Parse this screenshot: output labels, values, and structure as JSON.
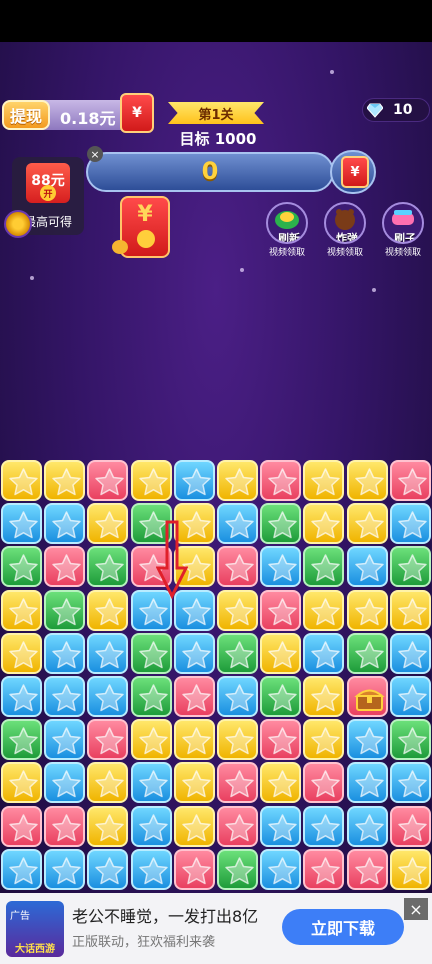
{
  "header": {
    "withdraw_label": "提现",
    "balance": "0.18元",
    "redpack_symbol": "¥",
    "level_label": "第1关",
    "target_label": "目标 1000",
    "gem_icon": "diamond-icon",
    "gem_count": "10"
  },
  "score_bar": {
    "score": "0",
    "redpack_symbol": "¥"
  },
  "max_card": {
    "close_symbol": "×",
    "amount": "88元",
    "open_label": "开",
    "label": "最高可得",
    "settings_icon": "gear-icon"
  },
  "center_redpack": {
    "symbol": "¥"
  },
  "powerups": [
    {
      "label": "刷新",
      "sub": "视频领取",
      "icon": "refresh-plant-icon",
      "color": "#2bb24c"
    },
    {
      "label": "炸弹",
      "sub": "视频领取",
      "icon": "bomb-bear-icon",
      "color": "#7a3b18"
    },
    {
      "label": "刷子",
      "sub": "视频领取",
      "icon": "brush-icon",
      "color": "#ff6fb0"
    }
  ],
  "board": {
    "rows": 10,
    "cols": 10,
    "colors": {
      "Y": "yellow",
      "P": "pink",
      "B": "blue",
      "G": "green",
      "C": "chest"
    },
    "grid": [
      "YYPYBYPYYP",
      "BBYGYBGYYB",
      "GPGPYPBGBG",
      "YGYBBYPYYY",
      "YBBGBGYBGB",
      "BBBGPBGYCB",
      "GBPYYYPYBG",
      "YBYBYPYPBB",
      "PPYBYPBBBP",
      "BBBBPGBPPY"
    ],
    "hint_arrow_color": "#e0202a"
  },
  "ad": {
    "tag": "广告",
    "app_name": "大话西游",
    "title": "老公不睡觉，一发打出8亿",
    "subtitle": "正版联动，狂欢福利来袭",
    "cta": "立即下载",
    "close_symbol": "×"
  }
}
